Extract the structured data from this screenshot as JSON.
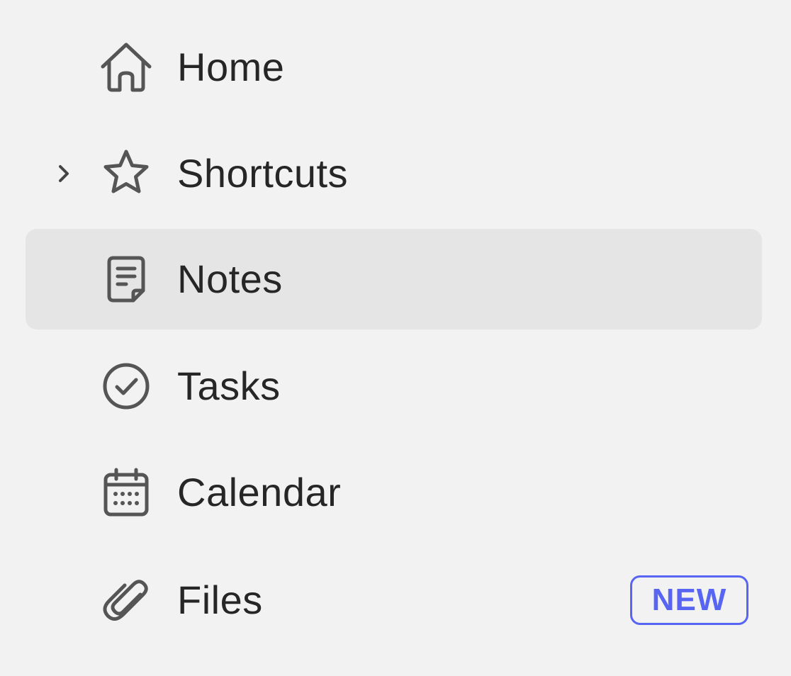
{
  "sidebar": {
    "items": [
      {
        "id": "home",
        "label": "Home",
        "icon": "home-icon",
        "selected": false,
        "expandable": false
      },
      {
        "id": "shortcuts",
        "label": "Shortcuts",
        "icon": "star-icon",
        "selected": false,
        "expandable": true
      },
      {
        "id": "notes",
        "label": "Notes",
        "icon": "note-icon",
        "selected": true,
        "expandable": false
      },
      {
        "id": "tasks",
        "label": "Tasks",
        "icon": "check-circle-icon",
        "selected": false,
        "expandable": false
      },
      {
        "id": "calendar",
        "label": "Calendar",
        "icon": "calendar-icon",
        "selected": false,
        "expandable": false
      },
      {
        "id": "files",
        "label": "Files",
        "icon": "paperclip-icon",
        "selected": false,
        "expandable": false,
        "badge": "NEW"
      }
    ]
  },
  "colors": {
    "background": "#f2f2f2",
    "selected_background": "#e5e5e5",
    "text": "#262626",
    "icon": "#555555",
    "badge_accent": "#5865f2"
  }
}
